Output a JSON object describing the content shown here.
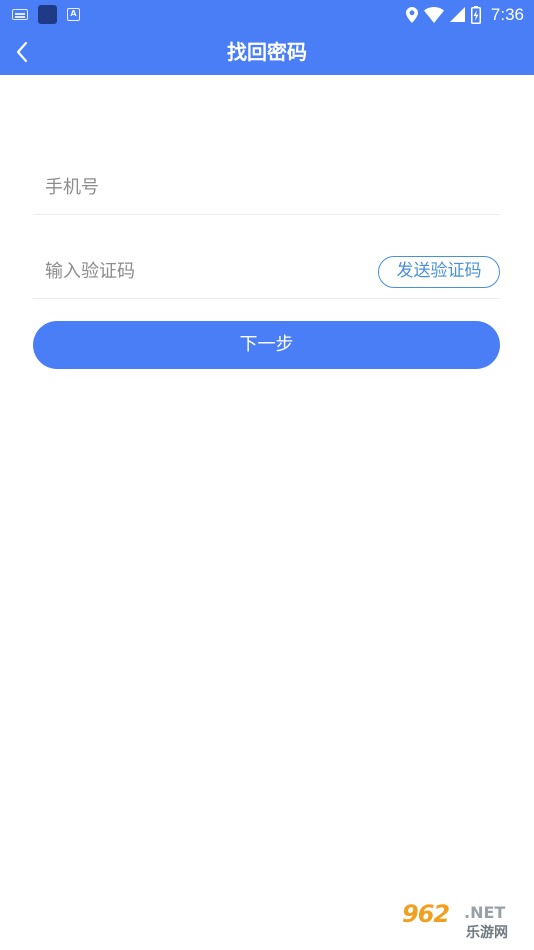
{
  "status_bar": {
    "time": "7:36",
    "icons": [
      "keyboard-icon",
      "app-icon",
      "font-icon",
      "location-icon",
      "wifi-icon",
      "signal-icon",
      "battery-icon"
    ],
    "a_icon_letter": "A"
  },
  "header": {
    "title": "找回密码",
    "back_icon": "chevron-left-icon",
    "background": "#4a7ef7"
  },
  "form": {
    "phone": {
      "placeholder": "手机号",
      "value": ""
    },
    "code": {
      "placeholder": "输入验证码",
      "value": ""
    },
    "send_code_label": "发送验证码",
    "next_label": "下一步"
  },
  "watermark": {
    "logo": "962",
    "suffix": ".NET",
    "site_name": "乐游网"
  },
  "colors": {
    "accent": "#4a7ef7",
    "outline_button": "#4a90d9",
    "placeholder": "#8c8c8c",
    "divider": "#ececec"
  }
}
